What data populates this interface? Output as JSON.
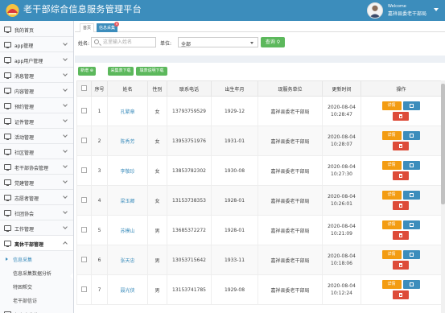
{
  "header": {
    "title": "老干部综合信息服务管理平台",
    "welcome": "Welcome",
    "user_name": "嘉祥县委老干部局"
  },
  "sidebar": {
    "items": [
      {
        "label": "我的首页",
        "icon": "home-icon"
      },
      {
        "label": "app管理",
        "icon": "monitor-icon"
      },
      {
        "label": "app用户管理",
        "icon": "monitor-icon"
      },
      {
        "label": "消息管理",
        "icon": "mail-icon"
      },
      {
        "label": "内容管理",
        "icon": "monitor-icon"
      },
      {
        "label": "预约管理",
        "icon": "monitor-icon"
      },
      {
        "label": "证件管理",
        "icon": "monitor-icon"
      },
      {
        "label": "活动管理",
        "icon": "monitor-icon"
      },
      {
        "label": "社区管理",
        "icon": "monitor-icon"
      },
      {
        "label": "老干部协会管理",
        "icon": "monitor-icon"
      },
      {
        "label": "党建管理",
        "icon": "monitor-icon"
      },
      {
        "label": "志愿者管理",
        "icon": "monitor-icon"
      },
      {
        "label": "社团协会",
        "icon": "monitor-icon"
      },
      {
        "label": "工作管理",
        "icon": "monitor-icon"
      },
      {
        "label": "离休干部管理",
        "icon": "monitor-icon"
      }
    ],
    "sub_items": [
      {
        "label": "信息采集"
      },
      {
        "label": "信息采集数据分析"
      },
      {
        "label": "特困帮交"
      },
      {
        "label": "老干部信访"
      }
    ],
    "bottom_partial": "红色文化传承"
  },
  "tabs": [
    {
      "label": "首页"
    },
    {
      "label": "信息采集"
    }
  ],
  "filter": {
    "name_label": "姓名:",
    "name_placeholder": "这里输入姓名",
    "unit_label": "单位:",
    "unit_value": "全部",
    "query_label": "查询"
  },
  "toolbar": {
    "add_label": "新增",
    "collect_download_label": "采集表下载",
    "guide_download_label": "填表说明下载"
  },
  "table": {
    "headers": [
      "序号",
      "姓名",
      "性别",
      "联系电话",
      "出生年月",
      "现服务单位",
      "更新时间",
      "操作"
    ],
    "detail_label": "详情",
    "rows": [
      {
        "no": "1",
        "name": "孔繁章",
        "gender": "女",
        "phone": "13793759529",
        "birth": "1929-12",
        "unit": "嘉祥县委老干部局",
        "date": "2020-08-04",
        "time": "10:28:47"
      },
      {
        "no": "2",
        "name": "陈秀芳",
        "gender": "女",
        "phone": "13953751976",
        "birth": "1931-01",
        "unit": "嘉祥县委老干部局",
        "date": "2020-08-04",
        "time": "10:28:07"
      },
      {
        "no": "3",
        "name": "李敬珍",
        "gender": "女",
        "phone": "13853782302",
        "birth": "1930-08",
        "unit": "嘉祥县委老干部局",
        "date": "2020-08-04",
        "time": "10:27:30"
      },
      {
        "no": "4",
        "name": "梁玉卿",
        "gender": "女",
        "phone": "13153738353",
        "birth": "1928-01",
        "unit": "嘉祥县委老干部局",
        "date": "2020-08-04",
        "time": "10:26:01"
      },
      {
        "no": "5",
        "name": "苏模山",
        "gender": "男",
        "phone": "13685372272",
        "birth": "1928-01",
        "unit": "嘉祥县委老干部局",
        "date": "2020-08-04",
        "time": "10:21:09"
      },
      {
        "no": "6",
        "name": "张天忠",
        "gender": "男",
        "phone": "13053715642",
        "birth": "1933-11",
        "unit": "嘉祥县委老干部局",
        "date": "2020-08-04",
        "time": "10:18:06"
      },
      {
        "no": "7",
        "name": "聂光侠",
        "gender": "男",
        "phone": "13153741785",
        "birth": "1929-08",
        "unit": "嘉祥县委老干部局",
        "date": "2020-08-04",
        "time": "10:12:24"
      }
    ]
  },
  "colors": {
    "header_bg": "#3c8dbc",
    "success": "#5cb85c",
    "warning": "#f39c12",
    "danger": "#dd4b39",
    "primary": "#3c8dbc"
  }
}
